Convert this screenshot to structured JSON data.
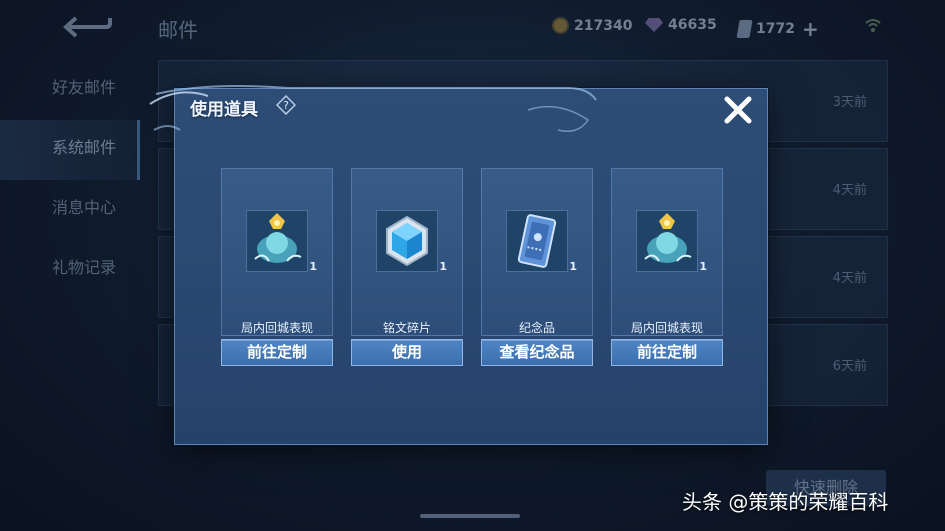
{
  "header": {
    "title": "邮件",
    "currencies": [
      {
        "icon": "gold-coin-icon",
        "value": "217340"
      },
      {
        "icon": "diamond-icon",
        "value": "46635"
      },
      {
        "icon": "voucher-icon",
        "value": "1772"
      }
    ]
  },
  "sidebar": {
    "items": [
      {
        "label": "好友邮件",
        "active": false
      },
      {
        "label": "系统邮件",
        "active": true
      },
      {
        "label": "消息中心",
        "active": false
      },
      {
        "label": "礼物记录",
        "active": false
      }
    ]
  },
  "mail_list": {
    "dates": [
      "3天前",
      "4天前",
      "4天前",
      "6天前"
    ],
    "bulk_button": "快速删除"
  },
  "modal": {
    "title": "使用道具",
    "items": [
      {
        "name": "局内回城表现",
        "icon": "recall-effect-icon",
        "quantity": "1",
        "button": "前往定制"
      },
      {
        "name": "铭文碎片",
        "icon": "inscription-fragment-icon",
        "quantity": "1",
        "button": "使用"
      },
      {
        "name": "纪念品",
        "icon": "souvenir-ticket-icon",
        "quantity": "1",
        "button": "查看纪念品"
      },
      {
        "name": "局内回城表现",
        "icon": "recall-effect-icon",
        "quantity": "1",
        "button": "前往定制"
      }
    ]
  },
  "watermark": "头条 @策策的荣耀百科",
  "colors": {
    "modal_bg": "#2d4d77",
    "button_bg": "#4f86c6",
    "page_bg": "#0f1a2b"
  }
}
